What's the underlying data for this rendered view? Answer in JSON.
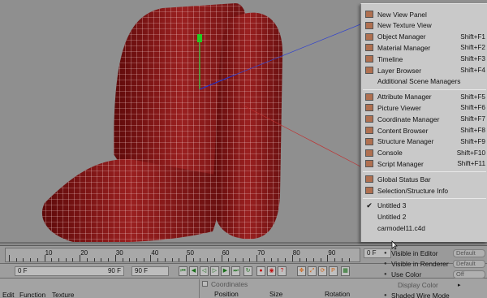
{
  "menu": {
    "items": [
      {
        "label": "New View Panel",
        "shortcut": "",
        "icon": "view-panel-icon",
        "check": false
      },
      {
        "label": "New Texture View",
        "shortcut": "",
        "icon": "texture-view-icon",
        "check": false
      },
      {
        "label": "Object Manager",
        "shortcut": "Shift+F1",
        "icon": "object-manager-icon",
        "check": false
      },
      {
        "label": "Material Manager",
        "shortcut": "Shift+F2",
        "icon": "material-manager-icon",
        "check": false
      },
      {
        "label": "Timeline",
        "shortcut": "Shift+F3",
        "icon": "timeline-icon",
        "check": false
      },
      {
        "label": "Layer Browser",
        "shortcut": "Shift+F4",
        "icon": "layer-browser-icon",
        "check": false
      },
      {
        "label": "Additional Scene Managers",
        "shortcut": "",
        "icon": "",
        "check": false
      },
      {
        "label": "Attribute Manager",
        "shortcut": "Shift+F5",
        "icon": "attribute-manager-icon",
        "check": false
      },
      {
        "label": "Picture Viewer",
        "shortcut": "Shift+F6",
        "icon": "picture-viewer-icon",
        "check": false
      },
      {
        "label": "Coordinate Manager",
        "shortcut": "Shift+F7",
        "icon": "coordinate-manager-icon",
        "check": false
      },
      {
        "label": "Content Browser",
        "shortcut": "Shift+F8",
        "icon": "content-browser-icon",
        "check": false
      },
      {
        "label": "Structure Manager",
        "shortcut": "Shift+F9",
        "icon": "structure-manager-icon",
        "check": false
      },
      {
        "label": "Console",
        "shortcut": "Shift+F10",
        "icon": "console-icon",
        "check": false
      },
      {
        "label": "Script Manager",
        "shortcut": "Shift+F11",
        "icon": "script-manager-icon",
        "check": false
      },
      {
        "label": "Global Status Bar",
        "shortcut": "",
        "icon": "status-bar-icon",
        "check": false
      },
      {
        "label": "Selection/Structure Info",
        "shortcut": "",
        "icon": "selection-info-icon",
        "check": false
      },
      {
        "label": "Untitled 3",
        "shortcut": "",
        "icon": "",
        "check": true
      },
      {
        "label": "Untitled 2",
        "shortcut": "",
        "icon": "",
        "check": false
      },
      {
        "label": "carmodel11.c4d",
        "shortcut": "",
        "icon": "",
        "check": false
      }
    ]
  },
  "timeline": {
    "ticks": [
      "10",
      "20",
      "30",
      "40",
      "50",
      "60",
      "70",
      "80",
      "90"
    ],
    "current_frame": "0 F",
    "start_frame": "0 F",
    "end_frame": "90 F",
    "max_frame": "90 F"
  },
  "bottom_menu": {
    "edit": "Edit",
    "function": "Function",
    "texture": "Texture"
  },
  "coordinates": {
    "title": "Coordinates",
    "position": "Position",
    "size": "Size",
    "rotation": "Rotation"
  },
  "attributes": {
    "visible_in_editor": "Visible in Editor",
    "visible_in_renderer": "Visible in Renderer",
    "use_color": "Use Color",
    "display_color": "Display Color",
    "shaded_wire_mode": "Shaded Wire Mode",
    "val_default": "Default",
    "val_off": "Off"
  },
  "colors": {
    "mesh": "#8a1a1a",
    "menu_bg": "#c9c9c9",
    "viewport_bg": "#8f8f8f"
  }
}
